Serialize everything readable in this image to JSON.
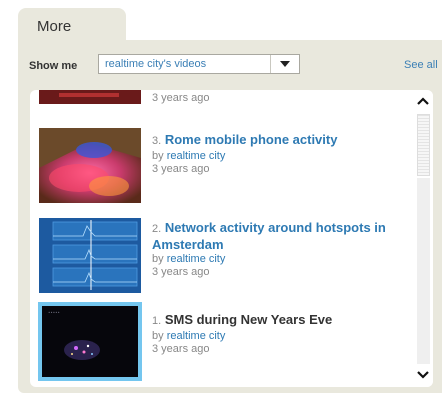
{
  "tab": {
    "label": "More"
  },
  "filter": {
    "label": "Show me",
    "selected": "realtime city's videos",
    "see_all": "See all"
  },
  "videos": [
    {
      "time": "3 years ago"
    },
    {
      "num": "3.",
      "title": "Rome mobile phone activity",
      "by": "by ",
      "author": "realtime city",
      "time": "3 years ago"
    },
    {
      "num": "2.",
      "title": "Network activity around hotspots in Amsterdam",
      "by": "by ",
      "author": "realtime city",
      "time": "3 years ago"
    },
    {
      "num": "1.",
      "title": "SMS during New Years Eve",
      "by": "by ",
      "author": "realtime city",
      "time": "3 years ago"
    }
  ],
  "icons": {
    "scroll_up": "chevron-up-icon",
    "scroll_down": "chevron-down-icon",
    "dropdown": "chevron-down-icon"
  },
  "colors": {
    "link": "#2e7ab3",
    "panel_bg": "#e9e8dd",
    "selected_thumb_border": "#74c6ef"
  }
}
